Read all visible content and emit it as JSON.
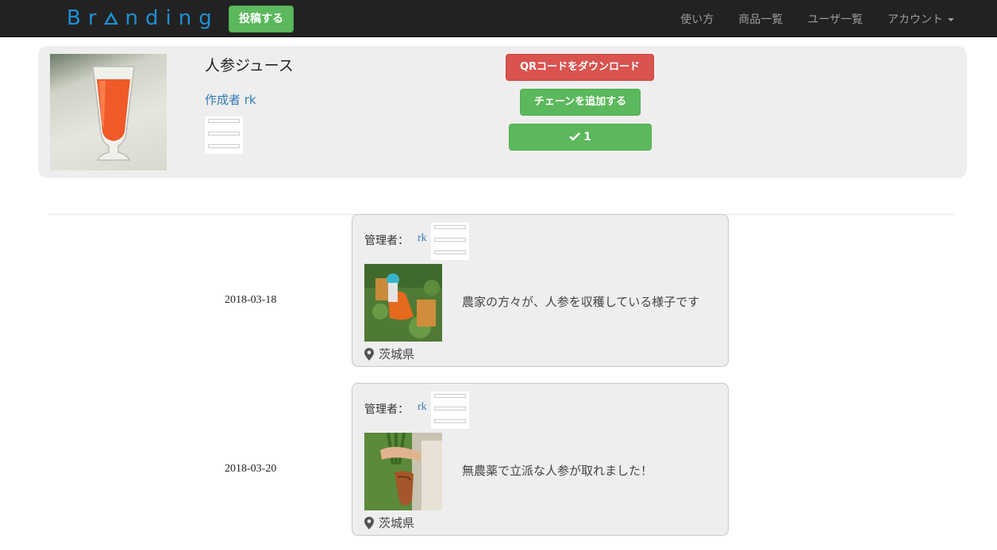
{
  "navbar": {
    "brand": {
      "before": "Br",
      "after": "nding"
    },
    "post_button": "投稿する",
    "links": [
      "使い方",
      "商品一覧",
      "ユーザ一覧"
    ],
    "account": "アカウント"
  },
  "product": {
    "title": "人参ジュース",
    "creator": "作成者 rk",
    "qr_button": "QRコードをダウンロード",
    "chain_button": "チェーンを追加する",
    "check_count": "1"
  },
  "timeline": [
    {
      "date": "2018-03-18",
      "admin_label": "管理者：",
      "admin_name": "rk",
      "description": "農家の方々が、人参を収穫している様子です",
      "location": "茨城県"
    },
    {
      "date": "2018-03-20",
      "admin_label": "管理者：",
      "admin_name": "rk",
      "description": "無農薬で立派な人参が取れました！",
      "location": "茨城県"
    }
  ],
  "colors": {
    "brand": "#1e8fd3",
    "success": "#5cb85c",
    "danger": "#d9534f",
    "link": "#337ab7",
    "navbar": "#222222"
  }
}
